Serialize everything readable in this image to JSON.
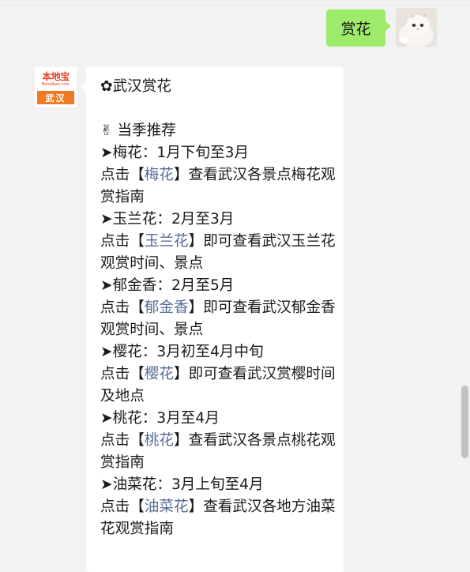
{
  "chat": {
    "outgoing": {
      "text": "赏花"
    },
    "incoming_account": {
      "logo_text": "本地宝",
      "logo_sub": "Bendibao.com",
      "city": "武汉"
    },
    "message": {
      "title": "✿武汉赏花",
      "section": "✌ 当季推荐",
      "items": [
        {
          "heading": "➤梅花：1月下旬至3月",
          "prefix": "点击【",
          "link": "梅花",
          "suffix": "】查看武汉各景点梅花观赏指南"
        },
        {
          "heading": "➤玉兰花：2月至3月",
          "prefix": "点击【",
          "link": "玉兰花",
          "suffix": "】即可查看武汉玉兰花观赏时间、景点"
        },
        {
          "heading": "➤郁金香：2月至5月",
          "prefix": "点击【",
          "link": "郁金香",
          "suffix": "】即可查看武汉郁金香观赏时间、景点"
        },
        {
          "heading": "➤樱花：3月初至4月中旬",
          "prefix": "点击【",
          "link": "樱花",
          "suffix": "】即可查看武汉赏樱时间及地点"
        },
        {
          "heading": "➤桃花：3月至4月",
          "prefix": "点击【",
          "link": "桃花",
          "suffix": "】查看武汉各景点桃花观赏指南"
        },
        {
          "heading": "➤油菜花：3月上旬至4月",
          "prefix": "点击【",
          "link": "油菜花",
          "suffix": "】查看武汉各地方油菜花观赏指南"
        }
      ]
    }
  },
  "colors": {
    "outgoing_bubble": "#9eea6a",
    "link": "#576b95",
    "logo_red": "#e8442a",
    "logo_orange": "#f07a22"
  }
}
